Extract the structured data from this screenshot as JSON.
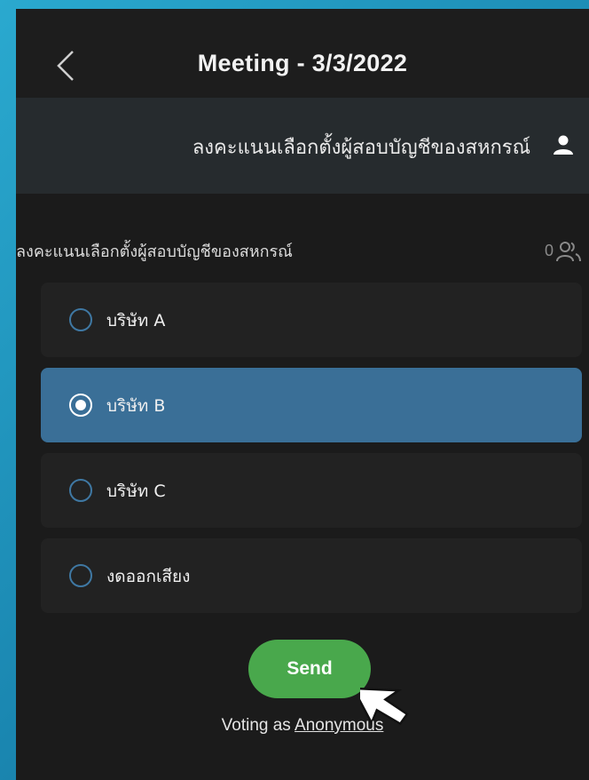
{
  "header": {
    "title": "Meeting - 3/3/2022",
    "back_icon": "chevron-left-icon"
  },
  "subheader": {
    "poll_name": "ลงคะแนนเลือกตั้งผู้สอบบัญชีของสหกรณ์",
    "user_icon": "person-icon"
  },
  "question": {
    "text": "ลงคะแนนเลือกตั้งผู้สอบบัญชีของสหกรณ์",
    "vote_count": "0",
    "count_icon": "people-icon"
  },
  "options": [
    {
      "label": "บริษัท A",
      "selected": false
    },
    {
      "label": "บริษัท B",
      "selected": true
    },
    {
      "label": "บริษัท C",
      "selected": false
    },
    {
      "label": "งดออกเสียง",
      "selected": false
    }
  ],
  "send_button": {
    "label": "Send"
  },
  "footer": {
    "voting_prefix": "Voting as ",
    "voting_identity": "Anonymous"
  },
  "colors": {
    "selected_option": "#3a6f97",
    "send_button": "#49a84c",
    "background": "#1b1b1b",
    "frame_gradient": "#2aa9cf"
  }
}
